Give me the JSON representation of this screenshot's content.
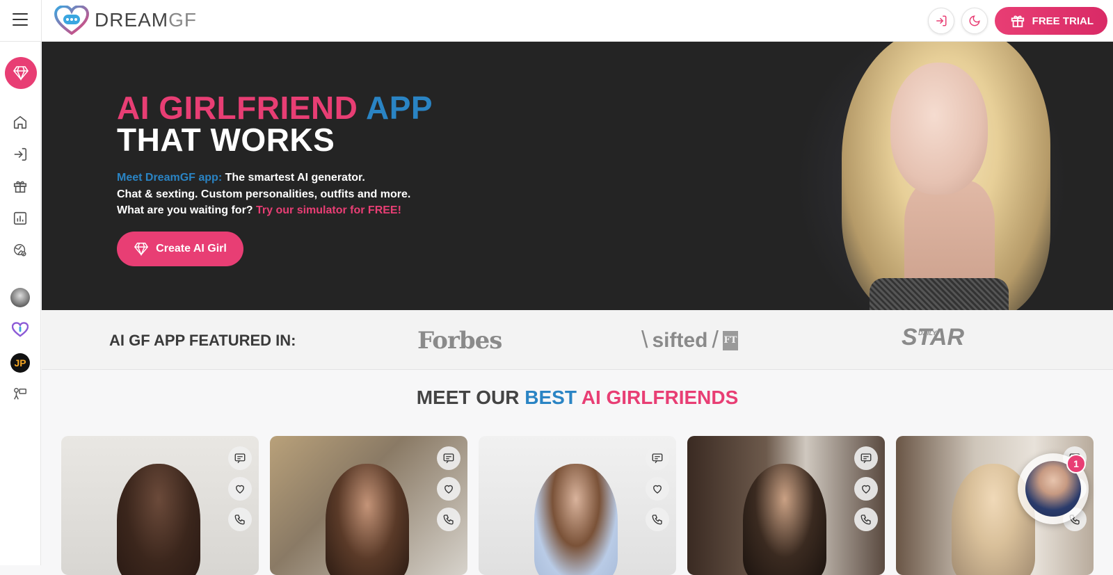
{
  "header": {
    "logo_text_main": "DREAM",
    "logo_text_accent": "GF",
    "free_trial_label": "FREE TRIAL"
  },
  "sidebar": {
    "items": [
      {
        "icon": "gem-icon"
      },
      {
        "icon": "home-icon"
      },
      {
        "icon": "login-icon"
      },
      {
        "icon": "gift-icon"
      },
      {
        "icon": "chart-icon"
      },
      {
        "icon": "globe-icon"
      },
      {
        "icon": "avatar-girl-icon"
      },
      {
        "icon": "heart-logo-icon"
      },
      {
        "icon": "jp-icon",
        "text": "JP"
      },
      {
        "icon": "camera-icon"
      }
    ]
  },
  "hero": {
    "title_part1": "AI GIRLFRIEND",
    "title_part2": "APP",
    "title_line2": "THAT WORKS",
    "line1_accent": "Meet DreamGF app:",
    "line1_rest": "The smartest AI generator.",
    "line2": "Chat & sexting. Custom personalities, outfits and more.",
    "line3_start": "What are you waiting for?",
    "line3_accent": "Try our simulator for FREE!",
    "cta_label": "Create AI Girl"
  },
  "featured": {
    "label": "AI GF APP FEATURED IN:",
    "logos": {
      "forbes": "Forbes",
      "sifted": "sifted",
      "ft": "FT",
      "star_main": "STAR",
      "star_small": "DAILY"
    }
  },
  "section": {
    "title_dark": "MEET OUR",
    "title_blue": "BEST",
    "title_pink": "AI GIRLFRIENDS"
  },
  "chat_widget": {
    "badge_count": "1"
  },
  "colors": {
    "accent_pink": "#e83e74",
    "accent_blue": "#2a84c4",
    "hero_bg": "#242424"
  }
}
